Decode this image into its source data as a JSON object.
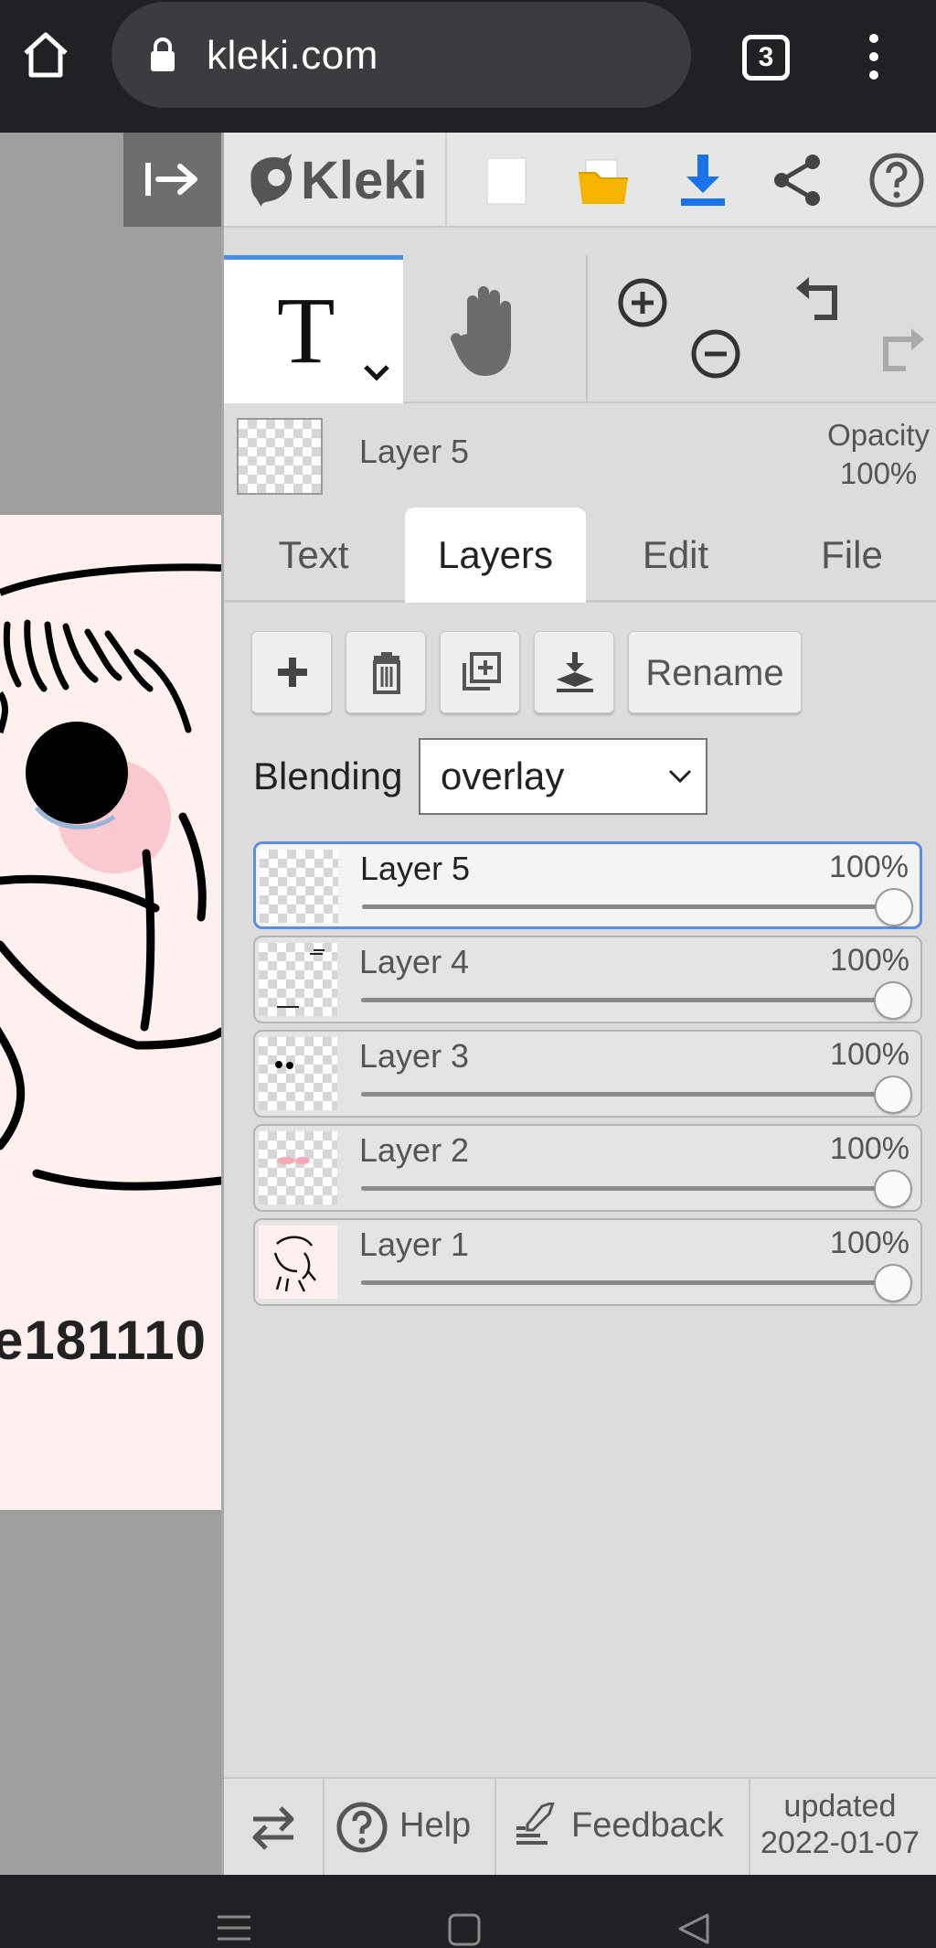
{
  "browser": {
    "url": "kleki.com",
    "tab_count": "3"
  },
  "canvas": {
    "caption": "e181110 #"
  },
  "toolbar": {
    "logo_text": "Kleki"
  },
  "current_layer": {
    "name": "Layer 5",
    "opacity_label": "Opacity",
    "opacity_value": "100%"
  },
  "tabs": [
    {
      "label": "Text",
      "active": false
    },
    {
      "label": "Layers",
      "active": true
    },
    {
      "label": "Edit",
      "active": false
    },
    {
      "label": "File",
      "active": false
    }
  ],
  "layer_actions": {
    "rename_label": "Rename"
  },
  "blending": {
    "label": "Blending",
    "value": "overlay"
  },
  "layers": [
    {
      "name": "Layer 5",
      "opacity": "100%",
      "opacity_value": 1.0,
      "selected": true
    },
    {
      "name": "Layer 4",
      "opacity": "100%",
      "opacity_value": 1.0,
      "selected": false
    },
    {
      "name": "Layer 3",
      "opacity": "100%",
      "opacity_value": 1.0,
      "selected": false
    },
    {
      "name": "Layer 2",
      "opacity": "100%",
      "opacity_value": 1.0,
      "selected": false
    },
    {
      "name": "Layer 1",
      "opacity": "100%",
      "opacity_value": 1.0,
      "selected": false
    }
  ],
  "footer": {
    "help_label": "Help",
    "feedback_label": "Feedback",
    "updated_label": "updated",
    "updated_date": "2022-01-07"
  },
  "colors": {
    "accent": "#4a90e2",
    "download_blue": "#1a73e8",
    "folder_yellow": "#f4b400"
  },
  "icons": [
    "home-icon",
    "lock-icon",
    "tabs-icon",
    "menu-icon",
    "collapse-panel-icon",
    "new-canvas-icon",
    "open-folder-icon",
    "download-icon",
    "share-icon",
    "help-icon",
    "text-tool-icon",
    "hand-tool-icon",
    "zoom-in-icon",
    "zoom-out-icon",
    "undo-icon",
    "redo-icon",
    "add-layer-icon",
    "delete-layer-icon",
    "duplicate-layer-icon",
    "merge-down-icon",
    "swap-side-icon",
    "feedback-icon"
  ]
}
